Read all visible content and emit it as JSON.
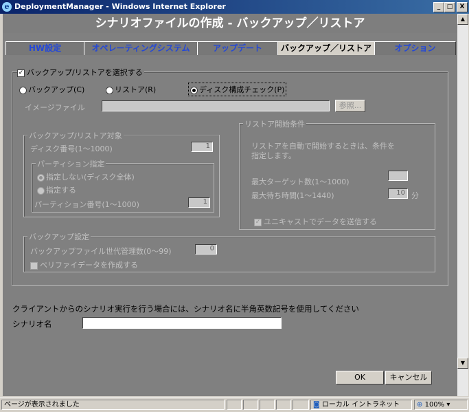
{
  "window": {
    "title": "DeploymentManager - Windows Internet Explorer",
    "minimize": "_",
    "maximize": "□",
    "close": "X"
  },
  "header": {
    "title": "シナリオファイルの作成 - バックアップ／リストア"
  },
  "tabs": [
    {
      "label": "HW設定",
      "active": false
    },
    {
      "label": "オペレーティングシステム",
      "active": false
    },
    {
      "label": "アップデート",
      "active": false
    },
    {
      "label": "バックアップ／リストア",
      "active": true
    },
    {
      "label": "オプション",
      "active": false
    }
  ],
  "main": {
    "select_checkbox_label": "バックアップ/リストアを選択する",
    "select_checked": true,
    "radios": [
      {
        "label": "バックアップ(C)",
        "checked": false
      },
      {
        "label": "リストア(R)",
        "checked": false
      },
      {
        "label": "ディスク構成チェック(P)",
        "checked": true
      }
    ],
    "image_file_label": "イメージファイル",
    "image_file_value": "",
    "browse_button": "参照...",
    "target": {
      "legend": "バックアップ/リストア対象",
      "disk_number_label": "ディスク番号(1～1000)",
      "disk_number_value": "1",
      "partition": {
        "legend": "パーティション指定",
        "option_all": "指定しない(ディスク全体)",
        "option_all_checked": true,
        "option_specify": "指定する",
        "partition_number_label": "パーティション番号(1～1000)",
        "partition_number_value": "1"
      }
    },
    "restore_start": {
      "legend": "リストア開始条件",
      "description_line1": "リストアを自動で開始するときは、条件を",
      "description_line2": "指定します。",
      "max_targets_label": "最大ターゲット数(1～1000)",
      "max_targets_value": "",
      "max_wait_label": "最大待ち時間(1～1440)",
      "max_wait_value": "10",
      "max_wait_unit": "分",
      "unicast_label": "ユニキャストでデータを送信する",
      "unicast_checked": true
    },
    "backup_settings": {
      "legend": "バックアップ設定",
      "generations_label": "バックアップファイル世代管理数(0～99)",
      "generations_value": "0",
      "verify_label": "ベリファイデータを作成する",
      "verify_checked": false
    },
    "scenario_note": "クライアントからのシナリオ実行を行う場合には、シナリオ名に半角英数記号を使用してください",
    "scenario_name_label": "シナリオ名",
    "scenario_name_value": "",
    "ok_button": "OK",
    "cancel_button": "キャンセル"
  },
  "statusbar": {
    "text": "ページが表示されました",
    "zone": "ローカル イントラネット",
    "zoom": "100%"
  }
}
